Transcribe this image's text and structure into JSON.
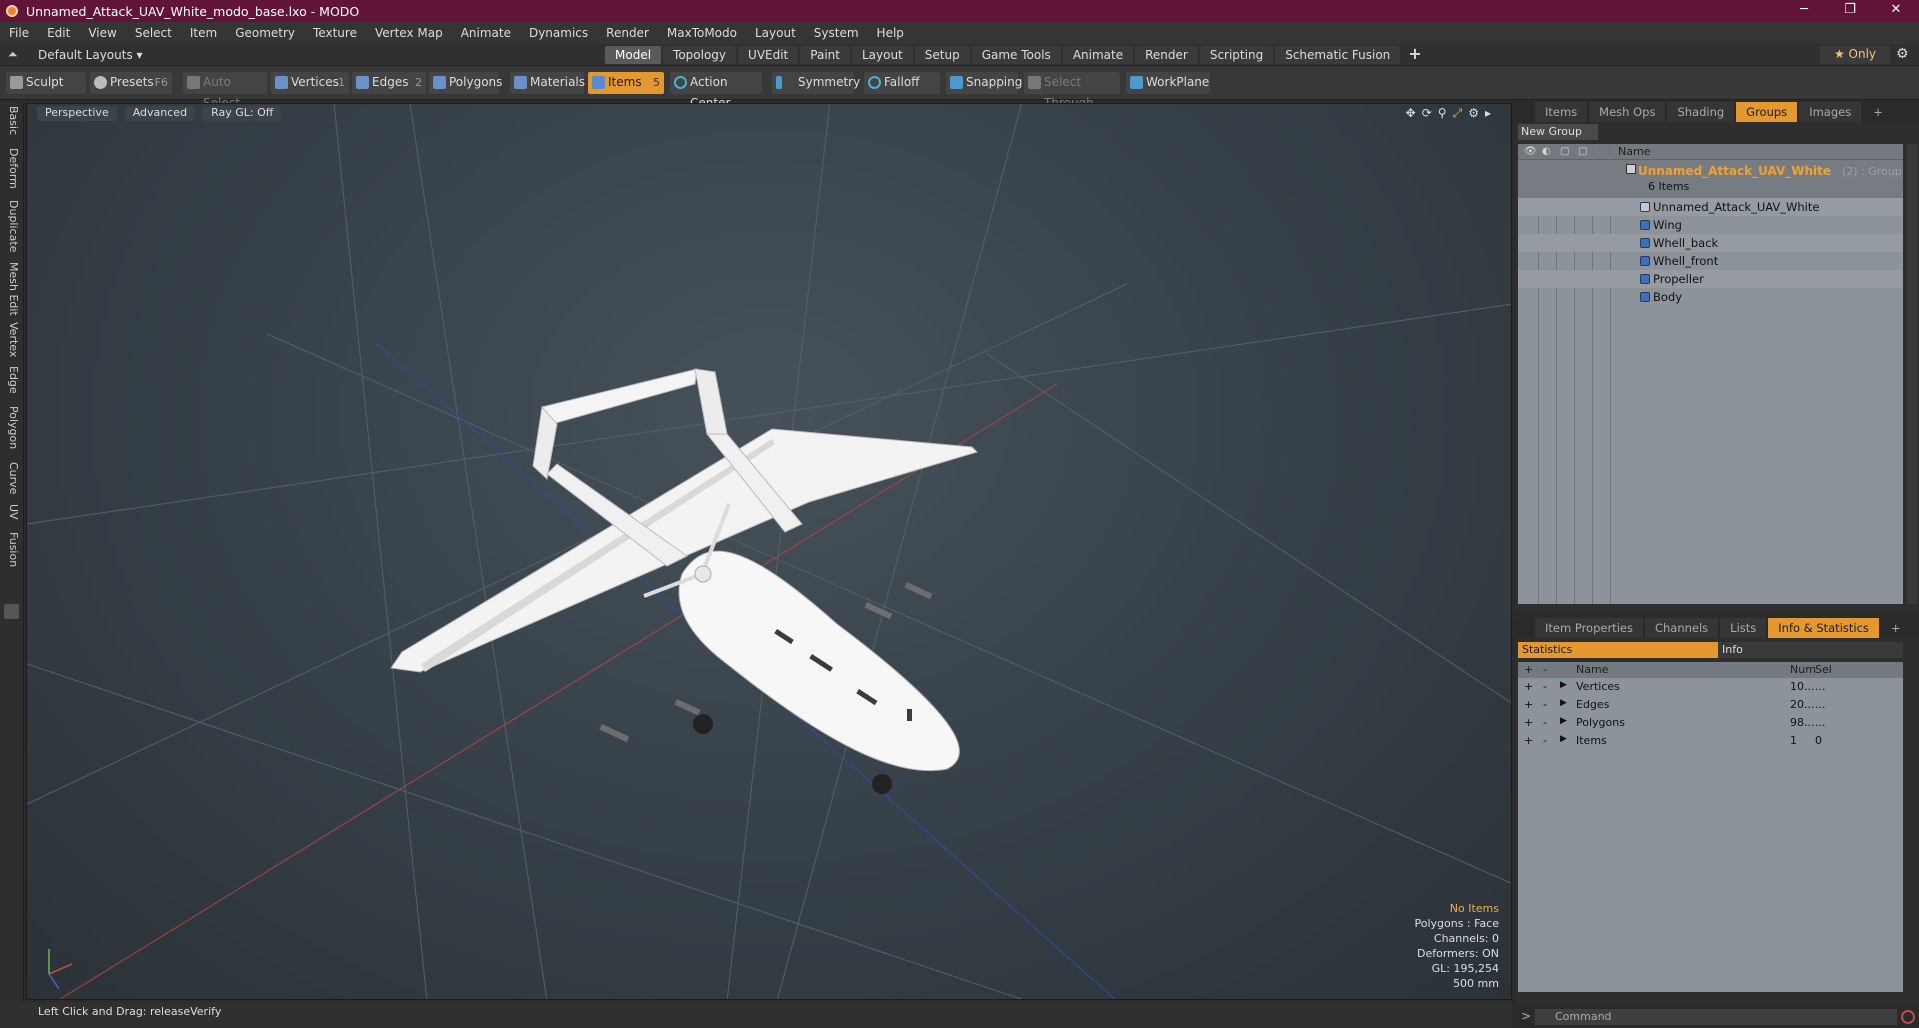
{
  "window": {
    "title": "Unnamed_Attack_UAV_White_modo_base.lxo - MODO",
    "min": "─",
    "max": "❐",
    "close": "✕"
  },
  "menu": [
    "File",
    "Edit",
    "View",
    "Select",
    "Item",
    "Geometry",
    "Texture",
    "Vertex Map",
    "Animate",
    "Dynamics",
    "Render",
    "MaxToModo",
    "Layout",
    "System",
    "Help"
  ],
  "layout": {
    "default": "Default Layouts ▾",
    "tabs": [
      "Model",
      "Topology",
      "UVEdit",
      "Paint",
      "Layout",
      "Setup",
      "Game Tools",
      "Animate",
      "Render",
      "Scripting",
      "Schematic Fusion"
    ],
    "active_tab": "Model",
    "only": "★  Only"
  },
  "toolbar": {
    "sculpt": "Sculpt",
    "presets": "Presets",
    "presets_key": "F6",
    "auto_select": "Auto Select",
    "vertices": "Vertices",
    "vertices_num": "1",
    "edges": "Edges",
    "edges_num": "2",
    "polygons": "Polygons",
    "materials": "Materials",
    "items": "Items",
    "items_num": "5",
    "action_center": "Action Center",
    "symmetry": "Symmetry",
    "falloff": "Falloff",
    "snapping": "Snapping",
    "select_through": "Select Through",
    "workplane": "WorkPlane"
  },
  "left_tabs": [
    "Basic",
    "Deform",
    "Duplicate",
    "Mesh Edit",
    "Vertex",
    "Edge",
    "Polygon",
    "Curve",
    "UV",
    "Fusion"
  ],
  "viewport": {
    "perspective": "Perspective",
    "advanced": "Advanced",
    "raygl": "Ray GL: Off",
    "info": {
      "no_items": "No Items",
      "polygons": "Polygons : Face",
      "channels": "Channels: 0",
      "deformers": "Deformers: ON",
      "gl": "GL: 195,254",
      "scale": "500 mm"
    }
  },
  "status": {
    "hint": "Left Click and Drag:  releaseVerify"
  },
  "groups_panel": {
    "tabs": [
      "Items",
      "Mesh Ops",
      "Shading",
      "Groups",
      "Images"
    ],
    "active": "Groups",
    "new_group": "New Group",
    "name_header": "Name",
    "group": {
      "name": "Unnamed_Attack_UAV_White",
      "suffix": "(2) : Group",
      "count": "6 Items"
    },
    "items": [
      "Unnamed_Attack_UAV_White",
      "Wing",
      "Whell_back",
      "Whell_front",
      "Propeller",
      "Body"
    ]
  },
  "props_panel": {
    "tabs": [
      "Item Properties",
      "Channels",
      "Lists",
      "Info & Statistics"
    ],
    "active": "Info & Statistics",
    "statistics": "Statistics",
    "info": "Info",
    "headers": {
      "name": "Name",
      "num": "Num",
      "sel": "Sel"
    },
    "rows": [
      {
        "name": "Vertices",
        "num": "10...",
        "sel": "..."
      },
      {
        "name": "Edges",
        "num": "20...",
        "sel": "..."
      },
      {
        "name": "Polygons",
        "num": "98...",
        "sel": "..."
      },
      {
        "name": "Items",
        "num": "1",
        "sel": "0"
      }
    ]
  },
  "command": {
    "placeholder": "Command"
  }
}
